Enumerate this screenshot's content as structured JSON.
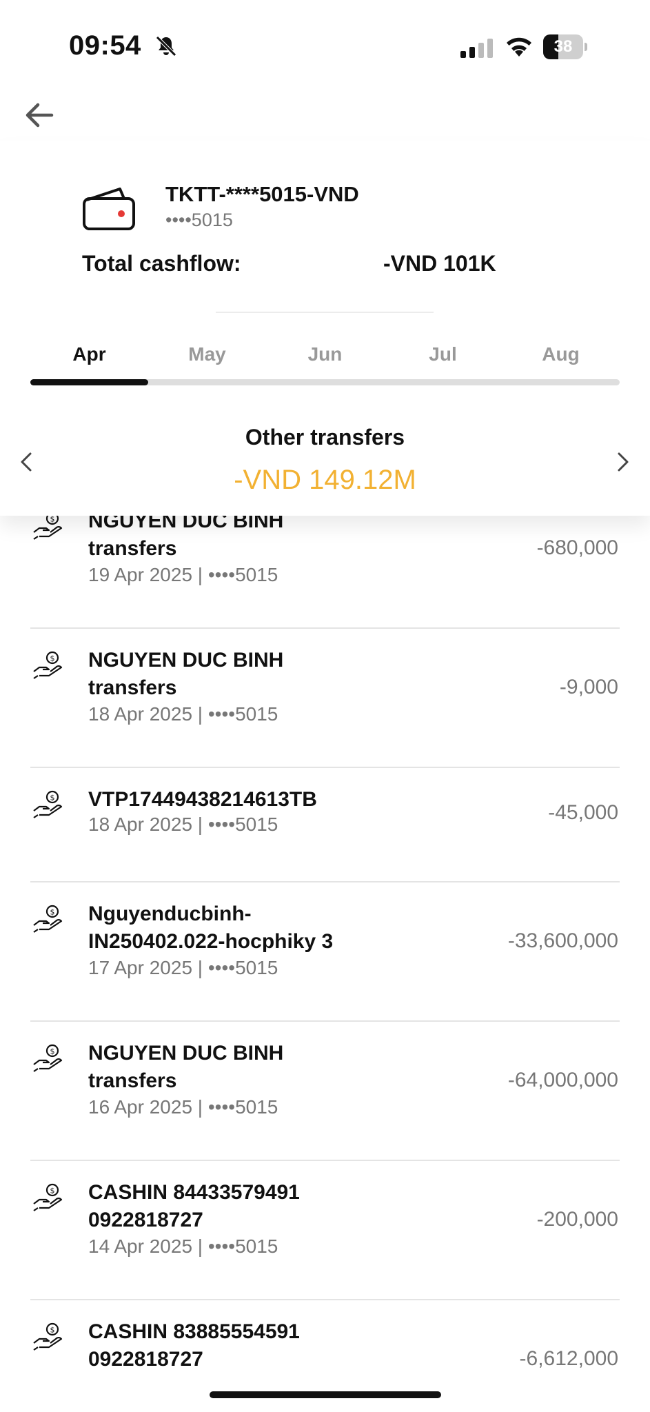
{
  "status_bar": {
    "time": "09:54",
    "battery": "38",
    "battery_level_percent": 38
  },
  "header": {
    "account_name": "TKTT-****5015-VND",
    "account_number": "••••5015",
    "cashflow_label": "Total cashflow:",
    "cashflow_value": "-VND 101K"
  },
  "tabs": [
    "Apr",
    "May",
    "Jun",
    "Jul",
    "Aug"
  ],
  "active_tab": "Apr",
  "category": {
    "title": "Other transfers",
    "amount": "-VND 149.12M",
    "amount_color": "#f2b132"
  },
  "transactions": [
    {
      "title_line1": "NGUYEN DUC BINH",
      "title_line2": "transfers",
      "date": "19 Apr 2025 | ••••5015",
      "amount": "-680,000"
    },
    {
      "title_line1": "NGUYEN DUC BINH",
      "title_line2": "transfers",
      "date": "18 Apr 2025 | ••••5015",
      "amount": "-9,000"
    },
    {
      "title_line1": "VTP17449438214613TB",
      "title_line2": "",
      "date": "18 Apr 2025 | ••••5015",
      "amount": "-45,000"
    },
    {
      "title_line1": "Nguyenducbinh-",
      "title_line2": "IN250402.022-hocphiky 3",
      "date": "17 Apr 2025 | ••••5015",
      "amount": "-33,600,000"
    },
    {
      "title_line1": "NGUYEN DUC BINH",
      "title_line2": "transfers",
      "date": "16 Apr 2025 | ••••5015",
      "amount": "-64,000,000"
    },
    {
      "title_line1": "CASHIN 84433579491",
      "title_line2": "0922818727",
      "date": "14 Apr 2025 | ••••5015",
      "amount": "-200,000"
    },
    {
      "title_line1": "CASHIN 83885554591",
      "title_line2": "0922818727",
      "date": "",
      "amount": "-6,612,000"
    }
  ],
  "colors": {
    "accent_wallet_dot": "#e53935",
    "amount_highlight": "#f2b132"
  },
  "icons": [
    "bell-slash-icon",
    "signal-icon",
    "wifi-icon",
    "back-arrow-icon",
    "wallet-icon",
    "chevron-left-icon",
    "chevron-right-icon",
    "money-hand-icon"
  ]
}
